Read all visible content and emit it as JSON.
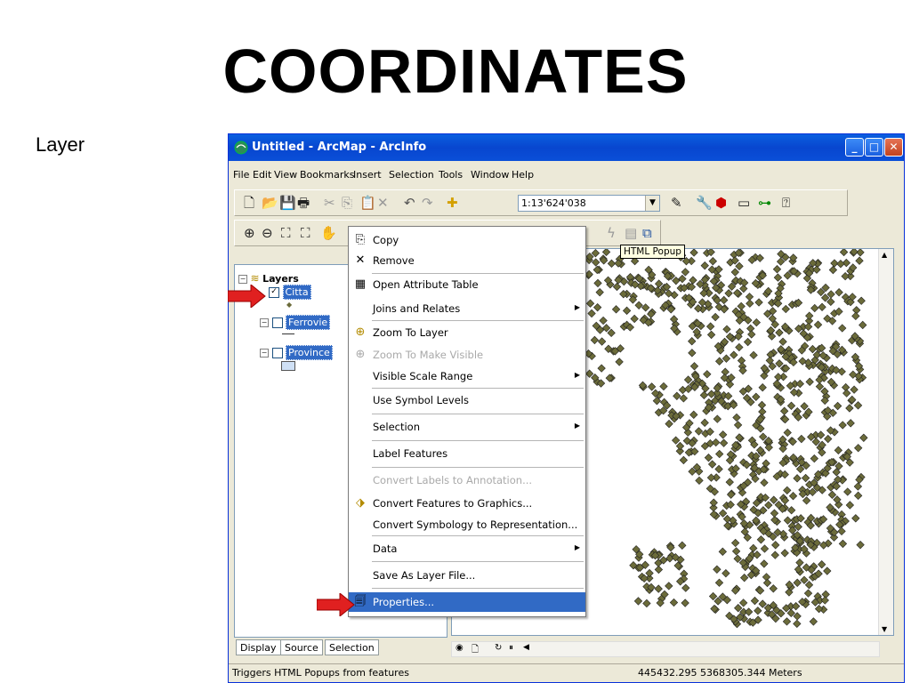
{
  "slide": {
    "title": "COORDINATES",
    "side_label": "Layer"
  },
  "window": {
    "title": "Untitled - ArcMap - ArcInfo",
    "controls": {
      "minimize": "_",
      "maximize": "□",
      "close": "✕"
    }
  },
  "menubar": [
    "File",
    "Edit",
    "View",
    "Bookmarks",
    "Insert",
    "Selection",
    "Tools",
    "Window",
    "Help"
  ],
  "toolbar": {
    "scale": "1:13'624'038"
  },
  "toc": {
    "root": "Layers",
    "layers": [
      {
        "name": "Citta",
        "checked": true
      },
      {
        "name": "Ferrovie",
        "checked": false
      },
      {
        "name": "Province",
        "checked": false
      }
    ],
    "check_mark": "✓",
    "expand_sign": "−"
  },
  "tabs": [
    "Display",
    "Source",
    "Selection"
  ],
  "tooltip": "HTML Popup",
  "context_menu": [
    {
      "label": "Copy",
      "icon": "copy-icon"
    },
    {
      "label": "Remove",
      "icon": "remove-icon"
    },
    {
      "label": "Open Attribute Table",
      "icon": "table-icon"
    },
    {
      "label": "Joins and Relates",
      "submenu": true
    },
    {
      "label": "Zoom To Layer",
      "icon": "zoom-layer-icon"
    },
    {
      "label": "Zoom To Make Visible",
      "disabled": true
    },
    {
      "label": "Visible Scale Range",
      "submenu": true
    },
    {
      "label": "Use Symbol Levels"
    },
    {
      "label": "Selection",
      "submenu": true
    },
    {
      "label": "Label Features"
    },
    {
      "label": "Convert Labels to Annotation...",
      "disabled": true
    },
    {
      "label": "Convert Features to Graphics...",
      "icon": "convert-graphics-icon"
    },
    {
      "label": "Convert Symbology to Representation..."
    },
    {
      "label": "Data",
      "submenu": true
    },
    {
      "label": "Save As Layer File..."
    },
    {
      "label": "Properties...",
      "selected": true,
      "icon": "properties-icon"
    }
  ],
  "status": {
    "message": "Triggers HTML Popups from features",
    "coordinates": "445432.295  5368305.344 Meters"
  },
  "colors": {
    "accent": "#316ac5",
    "titlebar": "#0a5fe0",
    "points": "#6b6b3a",
    "arrow": "#e02020"
  }
}
